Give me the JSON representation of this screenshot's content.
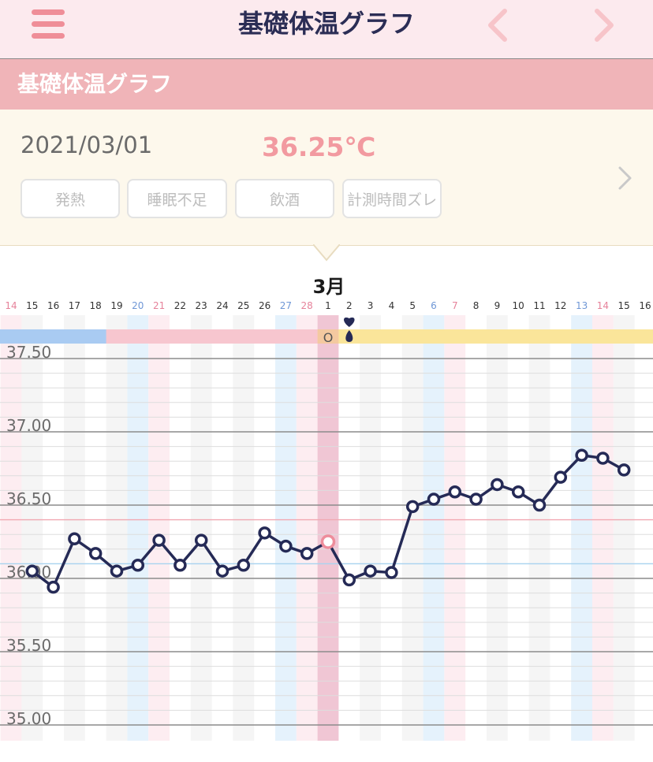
{
  "header": {
    "title": "基礎体温グラフ",
    "menu_icon": "hamburger-menu-icon",
    "prev_icon": "chevron-left-icon",
    "next_icon": "chevron-right-icon"
  },
  "section": {
    "title": "基礎体温グラフ"
  },
  "record": {
    "date": "2021/03/01",
    "temperature": "36.25℃",
    "tags": [
      "発熱",
      "睡眠不足",
      "飲酒",
      "計測時間ズレ"
    ],
    "detail_icon": "chevron-right-icon"
  },
  "colors": {
    "nav_bg": "#fceaee",
    "section_bg": "#f0b4b8",
    "info_bg": "#fdf8ec",
    "accent": "#f29aa0",
    "line": "#252a56",
    "saturday": "#6f97d6",
    "sunday": "#e6829a",
    "menstruation": "#a9cbf2",
    "follicular": "#f7c6cf",
    "luteal": "#fae59a"
  },
  "chart_data": {
    "type": "line",
    "month_label": "3月",
    "selected_day": "1",
    "days": [
      "14",
      "15",
      "16",
      "17",
      "18",
      "19",
      "20",
      "21",
      "22",
      "23",
      "24",
      "25",
      "26",
      "27",
      "28",
      "1",
      "2",
      "3",
      "4",
      "5",
      "6",
      "7",
      "8",
      "9",
      "10",
      "11",
      "12",
      "13",
      "14",
      "15",
      "16"
    ],
    "saturdays": [
      "20",
      "27",
      "6",
      "13"
    ],
    "sundays": [
      "14",
      "21",
      "28",
      "7",
      "14"
    ],
    "phase_bar": [
      {
        "phase": "menstruation",
        "from_index": 0,
        "to_index": 5
      },
      {
        "phase": "follicular",
        "from_index": 5,
        "to_index": 15
      },
      {
        "phase": "ovulation",
        "from_index": 15,
        "to_index": 16,
        "mark": "O"
      },
      {
        "phase": "luteal",
        "from_index": 16,
        "to_index": 31
      }
    ],
    "markers": [
      {
        "day_index": 16,
        "icons": [
          "heart-icon",
          "drop-icon"
        ]
      }
    ],
    "y_ticks": [
      "37.50",
      "37.00",
      "36.50",
      "36.00",
      "35.50",
      "35.00"
    ],
    "ylim": [
      35.0,
      37.5
    ],
    "reference_lines": [
      36.4,
      36.1
    ],
    "series": [
      {
        "values": [
          null,
          36.05,
          35.94,
          36.27,
          36.17,
          36.05,
          36.09,
          36.26,
          36.09,
          36.26,
          36.05,
          36.09,
          36.31,
          36.22,
          36.17,
          36.25,
          35.99,
          36.05,
          36.04,
          36.49,
          36.54,
          36.59,
          36.54,
          36.64,
          36.59,
          36.5,
          36.69,
          36.84,
          36.82,
          36.74,
          null
        ]
      }
    ]
  }
}
